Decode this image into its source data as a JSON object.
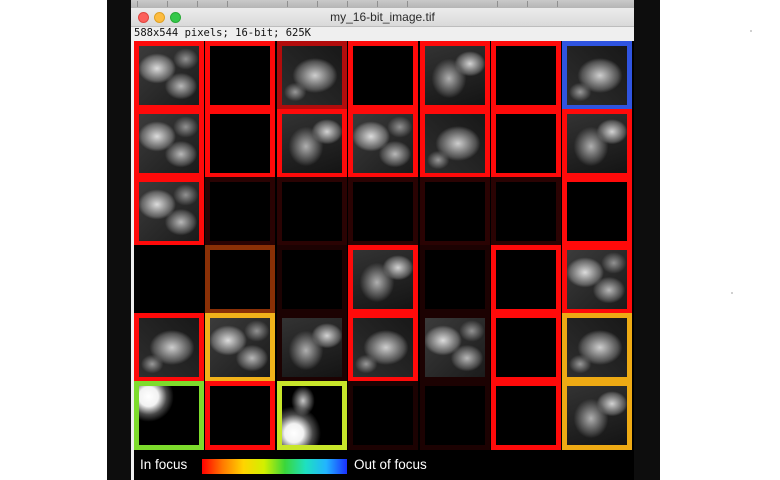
{
  "window": {
    "title": "my_16-bit_image.tif",
    "info": "588x544 pixels; 16-bit; 625K"
  },
  "grid": {
    "rows": 6,
    "cols": 7,
    "tiles": [
      {
        "row": 0,
        "col": 0,
        "border": "#ff0a0a",
        "content": "cells"
      },
      {
        "row": 0,
        "col": 1,
        "border": "#ff0a0a",
        "content": "dark"
      },
      {
        "row": 0,
        "col": 2,
        "border": "#b20c0c",
        "content": "cells-b"
      },
      {
        "row": 0,
        "col": 3,
        "border": "#ff0a0a",
        "content": "dark"
      },
      {
        "row": 0,
        "col": 4,
        "border": "#ff0a0a",
        "content": "cells-c"
      },
      {
        "row": 0,
        "col": 5,
        "border": "#ff0a0a",
        "content": "dark"
      },
      {
        "row": 0,
        "col": 6,
        "border": "#2f54e0",
        "content": "cells-b"
      },
      {
        "row": 1,
        "col": 0,
        "border": "#ff0a0a",
        "content": "cells"
      },
      {
        "row": 1,
        "col": 1,
        "border": "#ff0a0a",
        "content": "dark"
      },
      {
        "row": 1,
        "col": 2,
        "border": "#ff0a0a",
        "content": "cells-c"
      },
      {
        "row": 1,
        "col": 3,
        "border": "#ff0a0a",
        "content": "cells"
      },
      {
        "row": 1,
        "col": 4,
        "border": "#ff0a0a",
        "content": "cells-b"
      },
      {
        "row": 1,
        "col": 5,
        "border": "#ff0a0a",
        "content": "dark"
      },
      {
        "row": 1,
        "col": 6,
        "border": "#ff0a0a",
        "content": "cells-c"
      },
      {
        "row": 2,
        "col": 0,
        "border": "#ff0a0a",
        "content": "cells"
      },
      {
        "row": 2,
        "col": 1,
        "border": "#2a0303",
        "content": "dark"
      },
      {
        "row": 2,
        "col": 2,
        "border": "#2a0303",
        "content": "dark"
      },
      {
        "row": 2,
        "col": 3,
        "border": "#2a0303",
        "content": "dark"
      },
      {
        "row": 2,
        "col": 4,
        "border": "#2a0303",
        "content": "dark"
      },
      {
        "row": 2,
        "col": 5,
        "border": "#2a0303",
        "content": "dark"
      },
      {
        "row": 2,
        "col": 6,
        "border": "#ff0a0a",
        "content": "dark"
      },
      {
        "row": 3,
        "col": 0,
        "border": "#000000",
        "content": "dark"
      },
      {
        "row": 3,
        "col": 1,
        "border": "#8a3006",
        "content": "dark"
      },
      {
        "row": 3,
        "col": 2,
        "border": "#1c0202",
        "content": "dark"
      },
      {
        "row": 3,
        "col": 3,
        "border": "#ff0a0a",
        "content": "cells-c"
      },
      {
        "row": 3,
        "col": 4,
        "border": "#1c0202",
        "content": "dark"
      },
      {
        "row": 3,
        "col": 5,
        "border": "#ff0a0a",
        "content": "dark"
      },
      {
        "row": 3,
        "col": 6,
        "border": "#ff0a0a",
        "content": "cells"
      },
      {
        "row": 4,
        "col": 0,
        "border": "#ff0a0a",
        "content": "cells-b"
      },
      {
        "row": 4,
        "col": 1,
        "border": "#f2b21a",
        "content": "cells"
      },
      {
        "row": 4,
        "col": 2,
        "border": "#1c0202",
        "content": "cells-c"
      },
      {
        "row": 4,
        "col": 3,
        "border": "#ff0a0a",
        "content": "cells-b"
      },
      {
        "row": 4,
        "col": 4,
        "border": "#1c0202",
        "content": "cells"
      },
      {
        "row": 4,
        "col": 5,
        "border": "#ff0a0a",
        "content": "dark"
      },
      {
        "row": 4,
        "col": 6,
        "border": "#eeaa14",
        "content": "cells-b"
      },
      {
        "row": 5,
        "col": 0,
        "border": "#7ddc2c",
        "content": "blob"
      },
      {
        "row": 5,
        "col": 1,
        "border": "#ff0a0a",
        "content": "dark"
      },
      {
        "row": 5,
        "col": 2,
        "border": "#c8e62a",
        "content": "blob-low"
      },
      {
        "row": 5,
        "col": 3,
        "border": "#1c0202",
        "content": "dark"
      },
      {
        "row": 5,
        "col": 4,
        "border": "#1c0202",
        "content": "dark"
      },
      {
        "row": 5,
        "col": 5,
        "border": "#ff0a0a",
        "content": "dark"
      },
      {
        "row": 5,
        "col": 6,
        "border": "#eeaa14",
        "content": "cells-c"
      }
    ]
  },
  "legend": {
    "left_label": "In focus",
    "right_label": "Out of focus",
    "gradient_colors": [
      "#ff0000",
      "#ff7a00",
      "#ffd400",
      "#d2f000",
      "#3ad63a",
      "#1ee0c0",
      "#22b4ff",
      "#1a30ff"
    ]
  }
}
